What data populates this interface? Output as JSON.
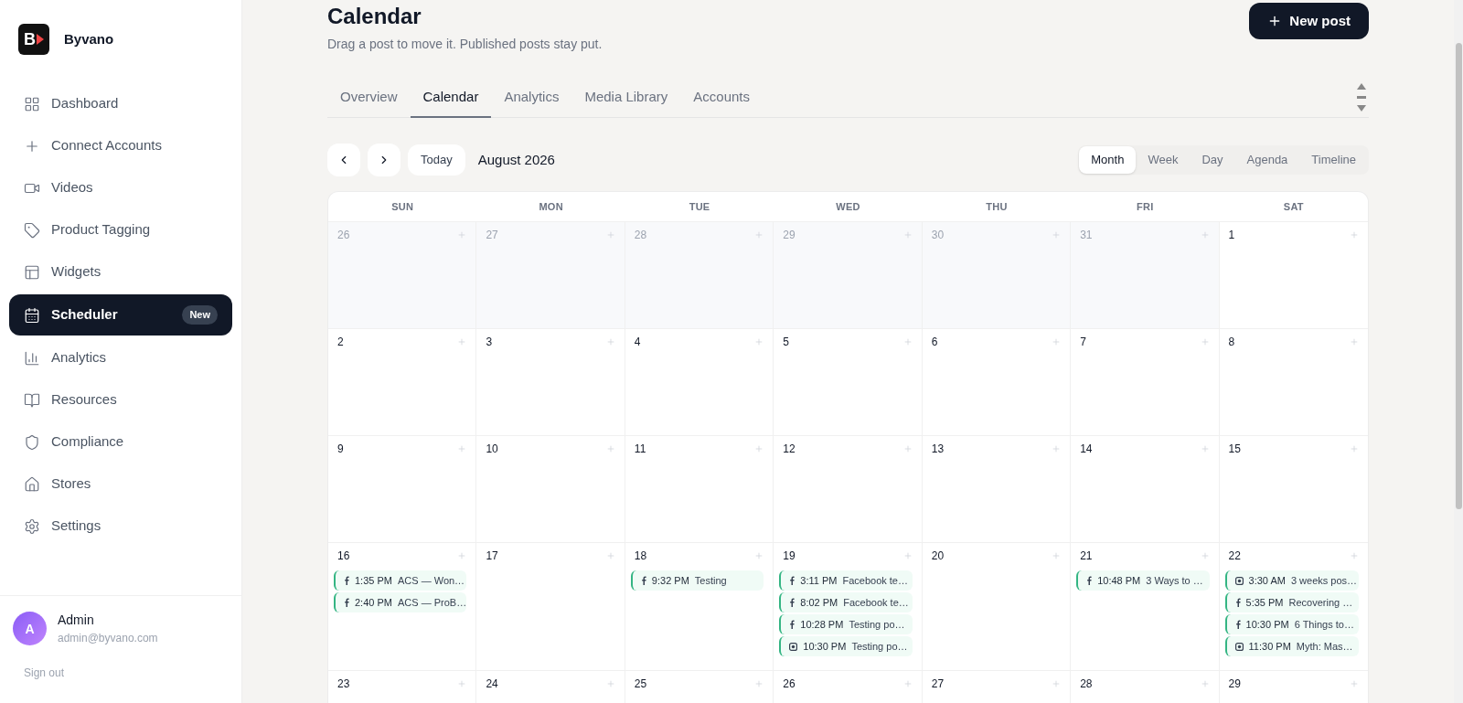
{
  "brand": {
    "name": "Byvano",
    "logo_letter": "B"
  },
  "nav": [
    {
      "label": "Dashboard",
      "selected": false
    },
    {
      "label": "Connect Accounts",
      "selected": false
    },
    {
      "label": "Videos",
      "selected": false
    },
    {
      "label": "Product Tagging",
      "selected": false
    },
    {
      "label": "Widgets",
      "selected": false
    },
    {
      "label": "Scheduler",
      "selected": true,
      "badge": "New"
    },
    {
      "label": "Analytics",
      "selected": false
    },
    {
      "label": "Resources",
      "selected": false
    },
    {
      "label": "Compliance",
      "selected": false
    },
    {
      "label": "Stores",
      "selected": false
    },
    {
      "label": "Settings",
      "selected": false
    }
  ],
  "user": {
    "initial": "A",
    "name": "Admin",
    "email": "admin@byvano.com",
    "sign_out": "Sign out"
  },
  "header": {
    "title": "Calendar",
    "subtitle": "Drag a post to move it. Published posts stay put.",
    "new_post": "New post"
  },
  "tabs": [
    {
      "label": "Overview",
      "selected": false
    },
    {
      "label": "Calendar",
      "selected": true
    },
    {
      "label": "Analytics",
      "selected": false
    },
    {
      "label": "Media Library",
      "selected": false
    },
    {
      "label": "Accounts",
      "selected": false
    }
  ],
  "toolbar": {
    "today": "Today",
    "month_label": "August 2026"
  },
  "views": [
    {
      "label": "Month",
      "selected": true
    },
    {
      "label": "Week",
      "selected": false
    },
    {
      "label": "Day",
      "selected": false
    },
    {
      "label": "Agenda",
      "selected": false
    },
    {
      "label": "Timeline",
      "selected": false
    }
  ],
  "weekdays": [
    "SUN",
    "MON",
    "TUE",
    "WED",
    "THU",
    "FRI",
    "SAT"
  ],
  "weeks": [
    [
      {
        "date": "26",
        "muted": true
      },
      {
        "date": "27",
        "muted": true
      },
      {
        "date": "28",
        "muted": true
      },
      {
        "date": "29",
        "muted": true
      },
      {
        "date": "30",
        "muted": true
      },
      {
        "date": "31",
        "muted": true
      },
      {
        "date": "1",
        "muted": false
      }
    ],
    [
      {
        "date": "2",
        "muted": false
      },
      {
        "date": "3",
        "muted": false
      },
      {
        "date": "4",
        "muted": false
      },
      {
        "date": "5",
        "muted": false
      },
      {
        "date": "6",
        "muted": false
      },
      {
        "date": "7",
        "muted": false
      },
      {
        "date": "8",
        "muted": false
      }
    ],
    [
      {
        "date": "9",
        "muted": false
      },
      {
        "date": "10",
        "muted": false
      },
      {
        "date": "11",
        "muted": false
      },
      {
        "date": "12",
        "muted": false
      },
      {
        "date": "13",
        "muted": false
      },
      {
        "date": "14",
        "muted": false
      },
      {
        "date": "15",
        "muted": false
      }
    ],
    [
      {
        "date": "16",
        "muted": false,
        "events": [
          {
            "kind": "facebook",
            "time": "1:35 PM",
            "title": "ACS — Won…"
          },
          {
            "kind": "facebook",
            "time": "2:40 PM",
            "title": "ACS — ProB…"
          }
        ]
      },
      {
        "date": "17",
        "muted": false
      },
      {
        "date": "18",
        "muted": false,
        "events": [
          {
            "kind": "facebook",
            "time": "9:32 PM",
            "title": "Testing"
          }
        ]
      },
      {
        "date": "19",
        "muted": false,
        "events": [
          {
            "kind": "facebook",
            "time": "3:11 PM",
            "title": "Facebook te…"
          },
          {
            "kind": "facebook",
            "time": "8:02 PM",
            "title": "Facebook te…"
          },
          {
            "kind": "facebook",
            "time": "10:28 PM",
            "title": "Testing po…"
          },
          {
            "kind": "instagram",
            "time": "10:30 PM",
            "title": "Testing po…"
          }
        ]
      },
      {
        "date": "20",
        "muted": false
      },
      {
        "date": "21",
        "muted": false,
        "events": [
          {
            "kind": "facebook",
            "time": "10:48 PM",
            "title": "3 Ways to …"
          }
        ]
      },
      {
        "date": "22",
        "muted": false,
        "events": [
          {
            "kind": "instagram",
            "time": "3:30 AM",
            "title": "3 weeks pos…"
          },
          {
            "kind": "facebook",
            "time": "5:35 PM",
            "title": "Recovering …"
          },
          {
            "kind": "facebook",
            "time": "10:30 PM",
            "title": "6 Things to…"
          },
          {
            "kind": "instagram",
            "time": "11:30 PM",
            "title": "Myth: Mas…"
          }
        ]
      }
    ],
    [
      {
        "date": "23",
        "muted": false
      },
      {
        "date": "24",
        "muted": false
      },
      {
        "date": "25",
        "muted": false
      },
      {
        "date": "26",
        "muted": false
      },
      {
        "date": "27",
        "muted": false
      },
      {
        "date": "28",
        "muted": false
      },
      {
        "date": "29",
        "muted": false
      }
    ]
  ]
}
